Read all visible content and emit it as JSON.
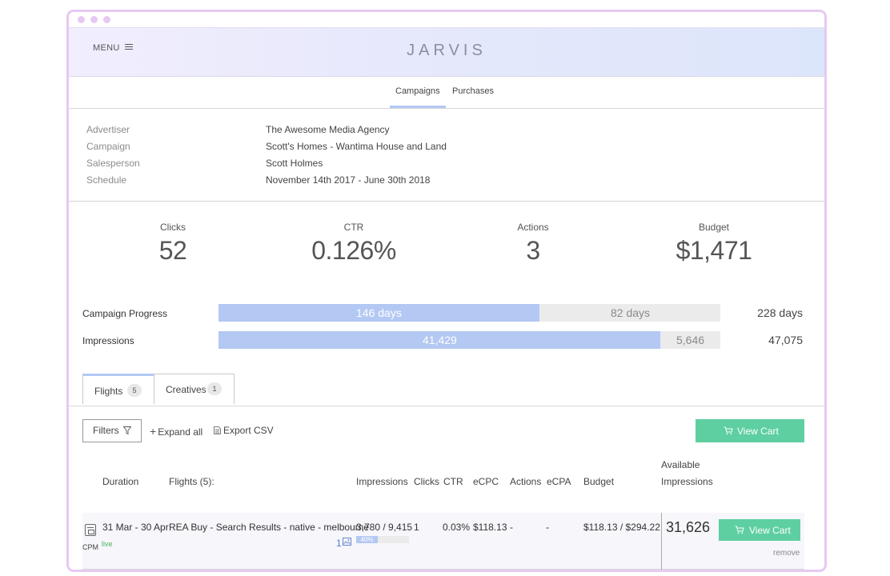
{
  "app": {
    "brand": "JARVIS",
    "menu_label": "MENU"
  },
  "nav": {
    "tabs": [
      {
        "label": "Campaigns",
        "active": true
      },
      {
        "label": "Purchases",
        "active": false
      }
    ]
  },
  "info": {
    "rows": [
      {
        "label": "Advertiser",
        "value": "The Awesome Media Agency"
      },
      {
        "label": "Campaign",
        "value": "Scott's Homes - Wantima House and Land"
      },
      {
        "label": "Salesperson",
        "value": "Scott Holmes"
      },
      {
        "label": "Schedule",
        "value": "November 14th 2017 - June 30th 2018"
      }
    ]
  },
  "stats": [
    {
      "label": "Clicks",
      "value": "52"
    },
    {
      "label": "CTR",
      "value": "0.126%"
    },
    {
      "label": "Actions",
      "value": "3"
    },
    {
      "label": "Budget",
      "value": "$1,471"
    }
  ],
  "progress": {
    "campaign": {
      "label": "Campaign Progress",
      "done": "146 days",
      "remaining": "82 days",
      "total": "228 days",
      "fraction": 0.64
    },
    "impressions": {
      "label": "Impressions",
      "done": "41,429",
      "remaining": "5,646",
      "total": "47,075",
      "fraction": 0.88
    }
  },
  "subtabs": [
    {
      "label": "Flights",
      "count": "5",
      "active": true
    },
    {
      "label": "Creatives",
      "count": "1",
      "active": false
    }
  ],
  "toolbar": {
    "filters": "Filters",
    "expand_all": "Expand all",
    "export_csv": "Export CSV",
    "view_cart": "View Cart"
  },
  "table": {
    "headers": {
      "duration": "Duration",
      "flights": "Flights (5):",
      "impressions": "Impressions",
      "clicks": "Clicks",
      "ctr": "CTR",
      "ecpc": "eCPC",
      "actions": "Actions",
      "ecpa": "eCPA",
      "budget": "Budget",
      "available_1": "Available",
      "available_2": "Impressions"
    },
    "rows": [
      {
        "duration": "31 Mar - 30 Apr",
        "type": "CPM",
        "status": "live",
        "flight": "REA Buy - Search Results - native - melbourne",
        "creatives": "1",
        "impressions": "3,780 / 9,415",
        "progress": "40%",
        "clicks": "1",
        "ctr": "0.03%",
        "ecpc": "$118.13",
        "actions": "-",
        "ecpa": "-",
        "budget": "$118.13 / $294.22",
        "available": "31,626",
        "view_cart": "View Cart",
        "remove": "remove"
      }
    ]
  },
  "colors": {
    "accent": "#b3c8f3",
    "cta": "#5ecfa0",
    "frame": "#e6c9f2",
    "live": "#4cb35a"
  }
}
